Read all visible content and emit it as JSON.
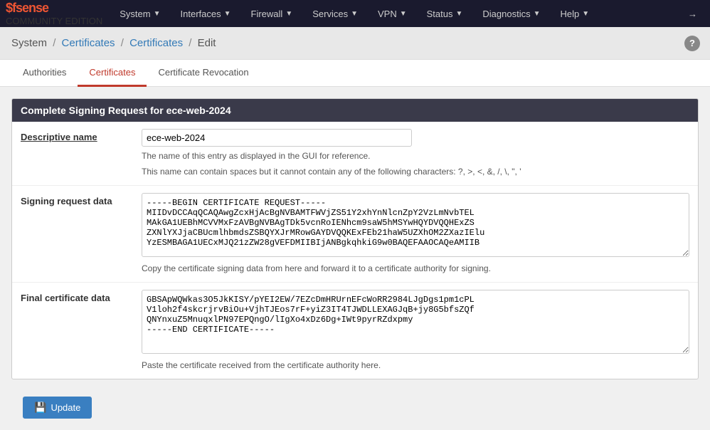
{
  "navbar": {
    "brand": "pfSense",
    "edition": "COMMUNITY EDITION",
    "items": [
      {
        "label": "System",
        "has_dropdown": true
      },
      {
        "label": "Interfaces",
        "has_dropdown": true
      },
      {
        "label": "Firewall",
        "has_dropdown": true
      },
      {
        "label": "Services",
        "has_dropdown": true
      },
      {
        "label": "VPN",
        "has_dropdown": true
      },
      {
        "label": "Status",
        "has_dropdown": true
      },
      {
        "label": "Diagnostics",
        "has_dropdown": true
      },
      {
        "label": "Help",
        "has_dropdown": true
      }
    ],
    "logout_icon": "→"
  },
  "breadcrumb": {
    "system": "System",
    "sep1": "/",
    "link1": "Certificates",
    "sep2": "/",
    "link2": "Certificates",
    "sep3": "/",
    "current": "Edit",
    "help_label": "?"
  },
  "tabs": [
    {
      "label": "Authorities",
      "active": false
    },
    {
      "label": "Certificates",
      "active": true
    },
    {
      "label": "Certificate Revocation",
      "active": false
    }
  ],
  "section": {
    "title": "Complete Signing Request for ece-web-2024",
    "fields": {
      "descriptive_name": {
        "label": "Descriptive name",
        "value": "ece-web-2024",
        "help1": "The name of this entry as displayed in the GUI for reference.",
        "help2": "This name can contain spaces but it cannot contain any of the following characters: ?, >, <, &, /, \\, \", '"
      },
      "signing_request": {
        "label": "Signing request data",
        "value": "-----BEGIN CERTIFICATE REQUEST-----\nMIIDvDCCAqQCAQAwgZcxHjAcBgNVBAMTFWVjZS51Y2xhYnNlcnZpY2VzLmNvbTEL\nMAkGA1UEBhMCVVMxFzAVBgNVBAgTDk5vcnRoIENhcm9saW5hMSYwHQYDVQQHExZS\nZXNlYXJjaCBUcmlhbmdsZSBQYXJrMRowGAYDVQQKExFEb21haW5UZXhOM2ZXazIElu\nYzESMBAGA1UECxMJQ21zZW28gVEFDMIIBIjANBgkqhkiG9w0BAQEFAAOCAQeAMIIB",
        "help": "Copy the certificate signing data from here and forward it to a certificate authority for signing."
      },
      "final_cert": {
        "label": "Final certificate data",
        "value": "GBSApWQWkas3O5JkKISY/pYEI2EW/7EZcDmHRUrnEFcWoRR2984LJgDgs1pm1cPL\nV1loh2f4skcrjrvBiOu+VjhTJEos7rF+yiZ3IT4TJWDLLEXAGJqB+jy8G5bfsZQf\nQNYnxuZ5MnuqxlPN97EPQngO/lIgXo4xDz6Dg+IWt9pyrRZdxpmy\n-----END CERTIFICATE-----",
        "help": "Paste the certificate received from the certificate authority here."
      }
    },
    "update_button": "Update"
  }
}
